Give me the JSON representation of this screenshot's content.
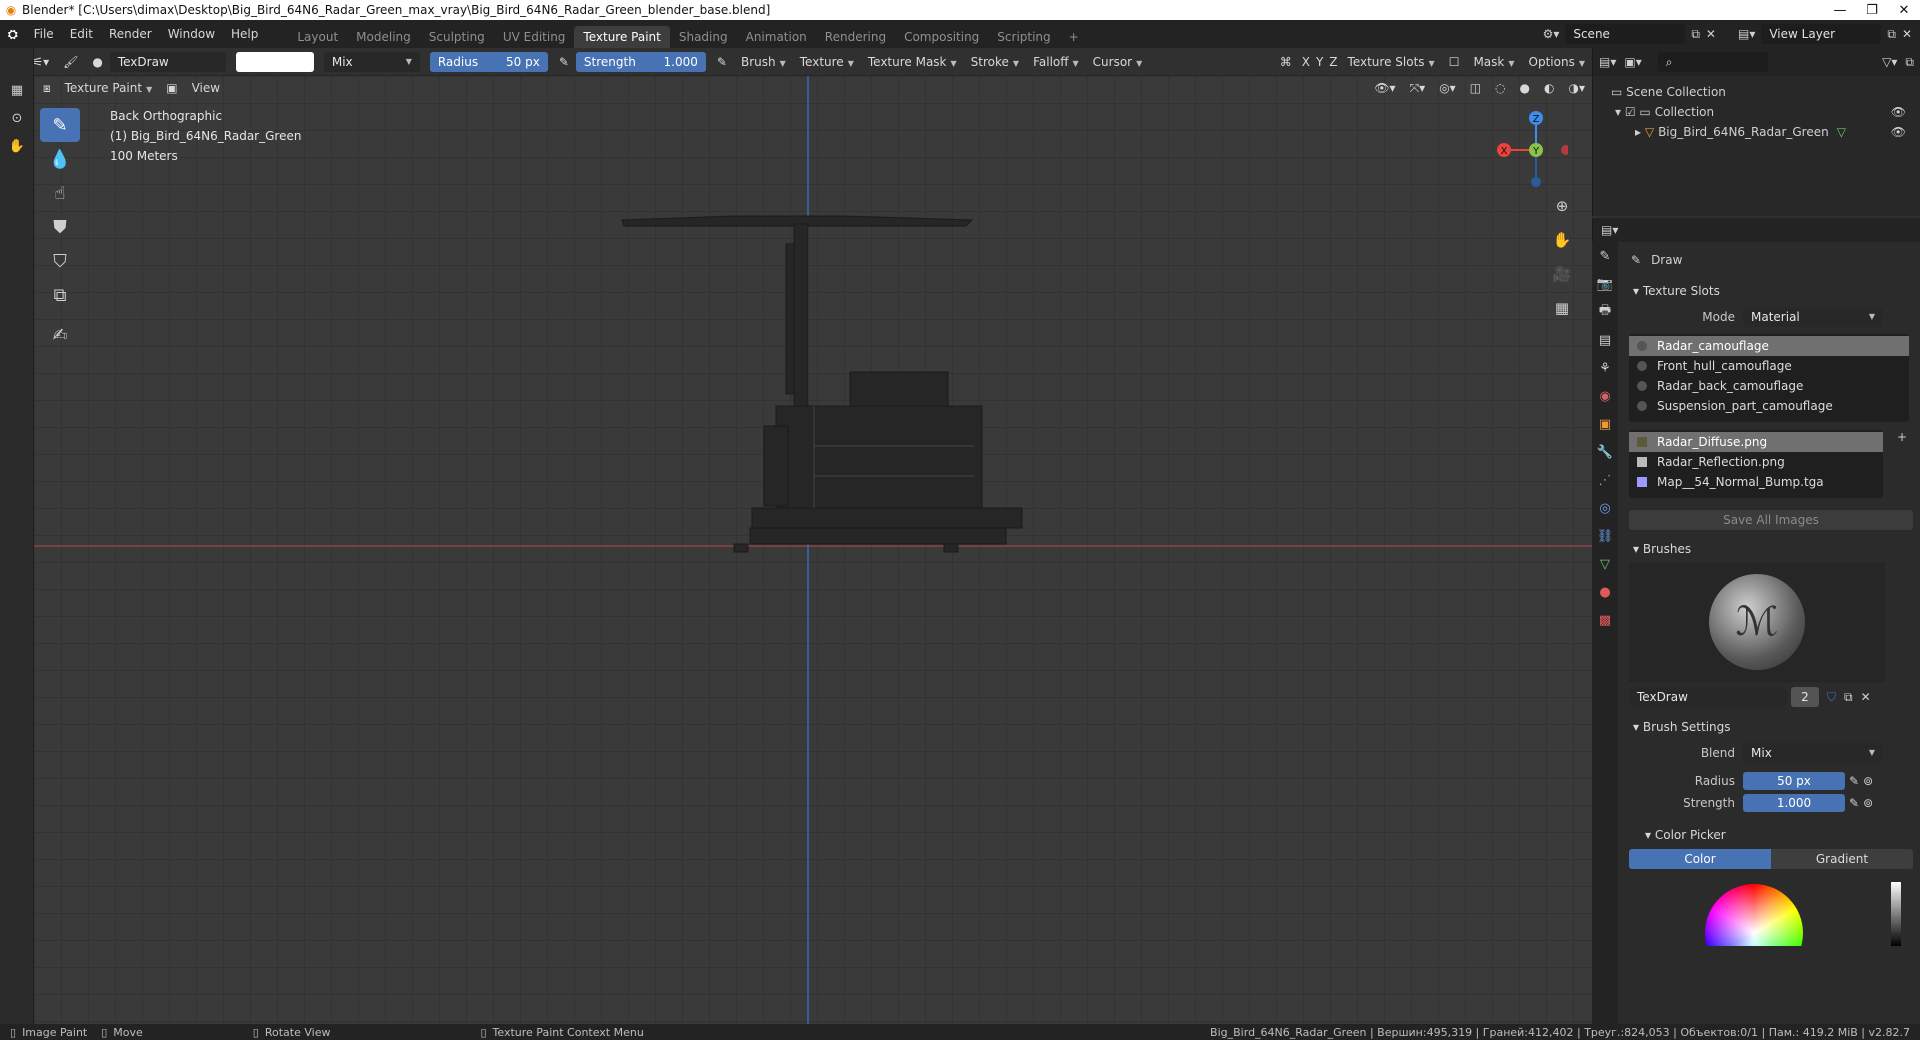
{
  "window": {
    "title": "Blender* [C:\\Users\\dimax\\Desktop\\Big_Bird_64N6_Radar_Green_max_vray\\Big_Bird_64N6_Radar_Green_blender_base.blend]"
  },
  "menu": [
    "File",
    "Edit",
    "Render",
    "Window",
    "Help"
  ],
  "workspaces": [
    "Layout",
    "Modeling",
    "Sculpting",
    "UV Editing",
    "Texture Paint",
    "Shading",
    "Animation",
    "Rendering",
    "Compositing",
    "Scripting"
  ],
  "add_tab": "+",
  "scene": {
    "label": "Scene",
    "view_layer": "View Layer"
  },
  "header": {
    "brush_name": "TexDraw",
    "blend": "Mix",
    "radius_label": "Radius",
    "radius_value": "50 px",
    "strength_label": "Strength",
    "strength_value": "1.000",
    "menus": [
      "Brush",
      "Texture",
      "Texture Mask",
      "Stroke",
      "Falloff",
      "Cursor"
    ],
    "axes": [
      "X",
      "Y",
      "Z"
    ],
    "texture_slots": "Texture Slots",
    "mask": "Mask",
    "options": "Options"
  },
  "header2": {
    "mode": "Texture Paint",
    "view": "View"
  },
  "viewport": {
    "view_name": "Back Orthographic",
    "object": "(1) Big_Bird_64N6_Radar_Green",
    "scale": "100 Meters"
  },
  "gizmo": {
    "x": "X",
    "y": "Y",
    "z": "Z"
  },
  "outliner": {
    "scene_collection": "Scene Collection",
    "collection": "Collection",
    "object": "Big_Bird_64N6_Radar_Green"
  },
  "props": {
    "tool_name": "Draw",
    "texture_slots_title": "Texture Slots",
    "mode_label": "Mode",
    "mode_value": "Material",
    "materials": [
      "Radar_camouflage",
      "Front_hull_camouflage",
      "Radar_back_camouflage",
      "Suspension_part_camouflage"
    ],
    "images": [
      "Radar_Diffuse.png",
      "Radar_Reflection.png",
      "Map__54_Normal_Bump.tga"
    ],
    "save_all": "Save All Images",
    "brushes_title": "Brushes",
    "brush_name": "TexDraw",
    "brush_users": "2",
    "brush_settings_title": "Brush Settings",
    "blend_label": "Blend",
    "blend_value": "Mix",
    "radius_label": "Radius",
    "radius_value": "50 px",
    "strength_label": "Strength",
    "strength_value": "1.000",
    "color_picker_title": "Color Picker",
    "color_tab": "Color",
    "gradient_tab": "Gradient"
  },
  "status": {
    "image_paint": "Image Paint",
    "move": "Move",
    "rotate": "Rotate View",
    "context": "Texture Paint Context Menu",
    "stats": "Big_Bird_64N6_Radar_Green | Вершин:495,319 | Граней:412,402 | Треуг.:824,053 | Объектов:0/1 | Пам.: 419.2 MiB | v2.82.7"
  },
  "colors": {
    "accent": "#4772b3",
    "x_axis": "#e8443a",
    "y_axis": "#8bc34a",
    "z_axis": "#3d8ee8"
  }
}
